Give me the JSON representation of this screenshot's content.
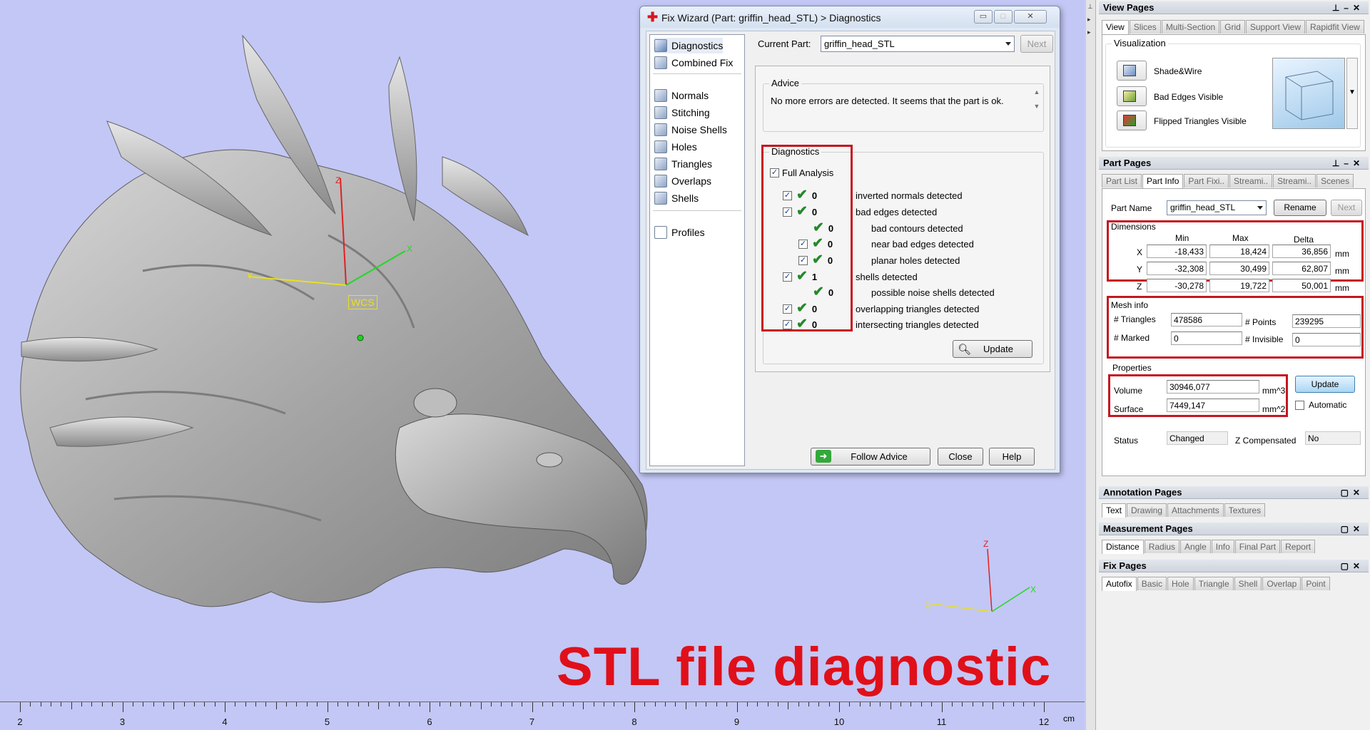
{
  "viewport": {
    "caption": "STL file diagnostic",
    "wcs_label": "WCS",
    "axis_labels": {
      "x": "X",
      "y": "Y",
      "z": "Z"
    },
    "ruler": {
      "labels": [
        "2",
        "3",
        "4",
        "5",
        "6",
        "7",
        "8",
        "9",
        "10",
        "11",
        "12"
      ],
      "unit": "cm"
    }
  },
  "wizard": {
    "title": "Fix Wizard (Part: griffin_head_STL) > Diagnostics",
    "window_buttons": {
      "minimize": "▭",
      "maximize": "□",
      "close": "✕"
    },
    "nav": {
      "top": [
        "Diagnostics",
        "Combined Fix"
      ],
      "middle": [
        "Normals",
        "Stitching",
        "Noise Shells",
        "Holes",
        "Triangles",
        "Overlaps",
        "Shells"
      ],
      "bottom": [
        "Profiles"
      ]
    },
    "current_part_label": "Current Part:",
    "current_part_value": "griffin_head_STL",
    "next_label": "Next",
    "advice_title": "Advice",
    "advice_text": "No more errors are detected. It seems that the part is ok.",
    "diagnostics_title": "Diagnostics",
    "full_analysis_label": "Full Analysis",
    "rows": [
      {
        "count": "0",
        "text": "inverted normals detected"
      },
      {
        "count": "0",
        "text": "bad edges detected"
      },
      {
        "count": "0",
        "text": "bad contours detected"
      },
      {
        "count": "0",
        "text": "near bad edges detected"
      },
      {
        "count": "0",
        "text": "planar holes detected"
      },
      {
        "count": "1",
        "text": "shells detected"
      },
      {
        "count": "0",
        "text": "possible noise shells detected"
      },
      {
        "count": "0",
        "text": "overlapping triangles detected"
      },
      {
        "count": "0",
        "text": "intersecting triangles detected"
      }
    ],
    "update_label": "Update",
    "follow_advice_label": "Follow Advice",
    "close_label": "Close",
    "help_label": "Help"
  },
  "view_pages": {
    "title": "View Pages",
    "tabs": [
      "View",
      "Slices",
      "Multi-Section",
      "Grid",
      "Support View",
      "Rapidfit View"
    ],
    "visualization_title": "Visualization",
    "items": [
      "Shade&Wire",
      "Bad Edges Visible",
      "Flipped Triangles Visible"
    ]
  },
  "part_pages": {
    "title": "Part Pages",
    "tabs": [
      "Part List",
      "Part Info",
      "Part Fixi..",
      "Streami..",
      "Streami..",
      "Scenes"
    ],
    "part_name_label": "Part Name",
    "part_name_value": "griffin_head_STL",
    "rename_label": "Rename",
    "next_label": "Next",
    "dimensions_title": "Dimensions",
    "dim_headers": [
      "Min",
      "Max",
      "Delta"
    ],
    "dims": [
      {
        "axis": "X",
        "min": "-18,433",
        "max": "18,424",
        "delta": "36,856",
        "unit": "mm"
      },
      {
        "axis": "Y",
        "min": "-32,308",
        "max": "30,499",
        "delta": "62,807",
        "unit": "mm"
      },
      {
        "axis": "Z",
        "min": "-30,278",
        "max": "19,722",
        "delta": "50,001",
        "unit": "mm"
      }
    ],
    "mesh_title": "Mesh info",
    "triangles_label": "# Triangles",
    "triangles_value": "478586",
    "points_label": "# Points",
    "points_value": "239295",
    "marked_label": "# Marked",
    "marked_value": "0",
    "invisible_label": "# Invisible",
    "invisible_value": "0",
    "properties_title": "Properties",
    "volume_label": "Volume",
    "volume_value": "30946,077",
    "volume_unit": "mm^3",
    "surface_label": "Surface",
    "surface_value": "7449,147",
    "surface_unit": "mm^2",
    "update_label": "Update",
    "automatic_label": "Automatic",
    "status_label": "Status",
    "status_value": "Changed",
    "zcomp_label": "Z Compensated",
    "zcomp_value": "No"
  },
  "annotation_pages": {
    "title": "Annotation Pages",
    "tabs": [
      "Text",
      "Drawing",
      "Attachments",
      "Textures"
    ]
  },
  "measurement_pages": {
    "title": "Measurement Pages",
    "tabs": [
      "Distance",
      "Radius",
      "Angle",
      "Info",
      "Final Part",
      "Report"
    ]
  },
  "fix_pages": {
    "title": "Fix Pages",
    "tabs": [
      "Autofix",
      "Basic",
      "Hole",
      "Triangle",
      "Shell",
      "Overlap",
      "Point"
    ]
  },
  "colors": {
    "viewport": "#c3c7f5",
    "highlight": "#c5161f",
    "check": "#238a2a",
    "caption": "#e0101a"
  }
}
